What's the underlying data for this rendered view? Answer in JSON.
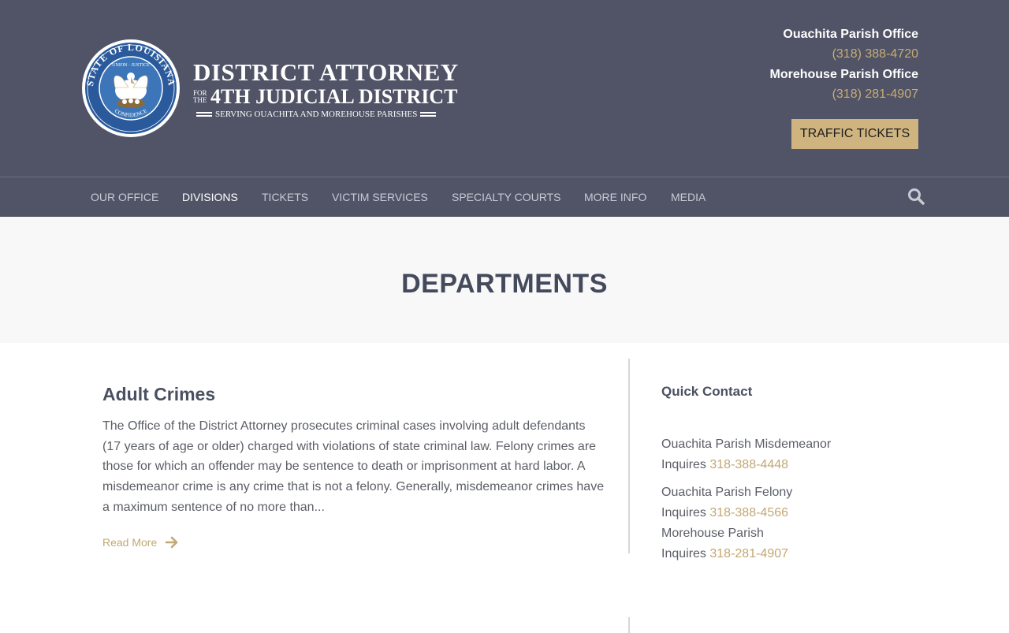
{
  "brand": {
    "title_line1": "DISTRICT ATTORNEY",
    "for_the": "FOR THE",
    "title_line2": "4TH JUDICIAL DISTRICT",
    "tagline": "SERVING OUACHITA AND MOREHOUSE PARISHES",
    "seal_text_top": "STATE OF LOUISIANA",
    "seal_text_union": "UNION · JUSTICE",
    "seal_text_bottom": "CONFIDENCE"
  },
  "header": {
    "offices": [
      {
        "name": "Ouachita Parish Office",
        "phone": "(318) 388-4720"
      },
      {
        "name": "Morehouse Parish Office",
        "phone": "(318) 281-4907"
      }
    ],
    "traffic_button": "TRAFFIC TICKETS"
  },
  "nav": {
    "items": [
      {
        "label": "OUR OFFICE"
      },
      {
        "label": "DIVISIONS"
      },
      {
        "label": "TICKETS"
      },
      {
        "label": "VICTIM SERVICES"
      },
      {
        "label": "SPECIALTY COURTS"
      },
      {
        "label": "MORE INFO"
      },
      {
        "label": "MEDIA"
      }
    ],
    "active": "DIVISIONS"
  },
  "banner": {
    "title": "DEPARTMENTS"
  },
  "article": {
    "title": "Adult Crimes",
    "body": "The Office of the District Attorney prosecutes criminal cases involving adult defendants (17 years of age or older) charged with violations of state criminal law. Felony crimes are those for which an offender may be sentence to death or imprisonment at hard labor.  A misdemeanor crime is any crime that is not a felony. Generally, misdemeanor crimes have a maximum sentence of no more than...",
    "read_more": "Read More"
  },
  "sidebar": {
    "title": "Quick Contact",
    "contacts": [
      {
        "line1": "Ouachita Parish Misdemeanor",
        "prefix": "Inquires",
        "phone": "318-388-4448"
      },
      {
        "line1": "Ouachita Parish Felony",
        "prefix": "Inquires",
        "phone": "318-388-4566"
      },
      {
        "line1": "Morehouse Parish",
        "prefix": "Inquires",
        "phone": "318-281-4907"
      }
    ]
  },
  "colors": {
    "header_bg": "#505466",
    "accent_gold": "#c8ab74",
    "button_bg": "#cfb47f",
    "heading": "#444a5c"
  }
}
